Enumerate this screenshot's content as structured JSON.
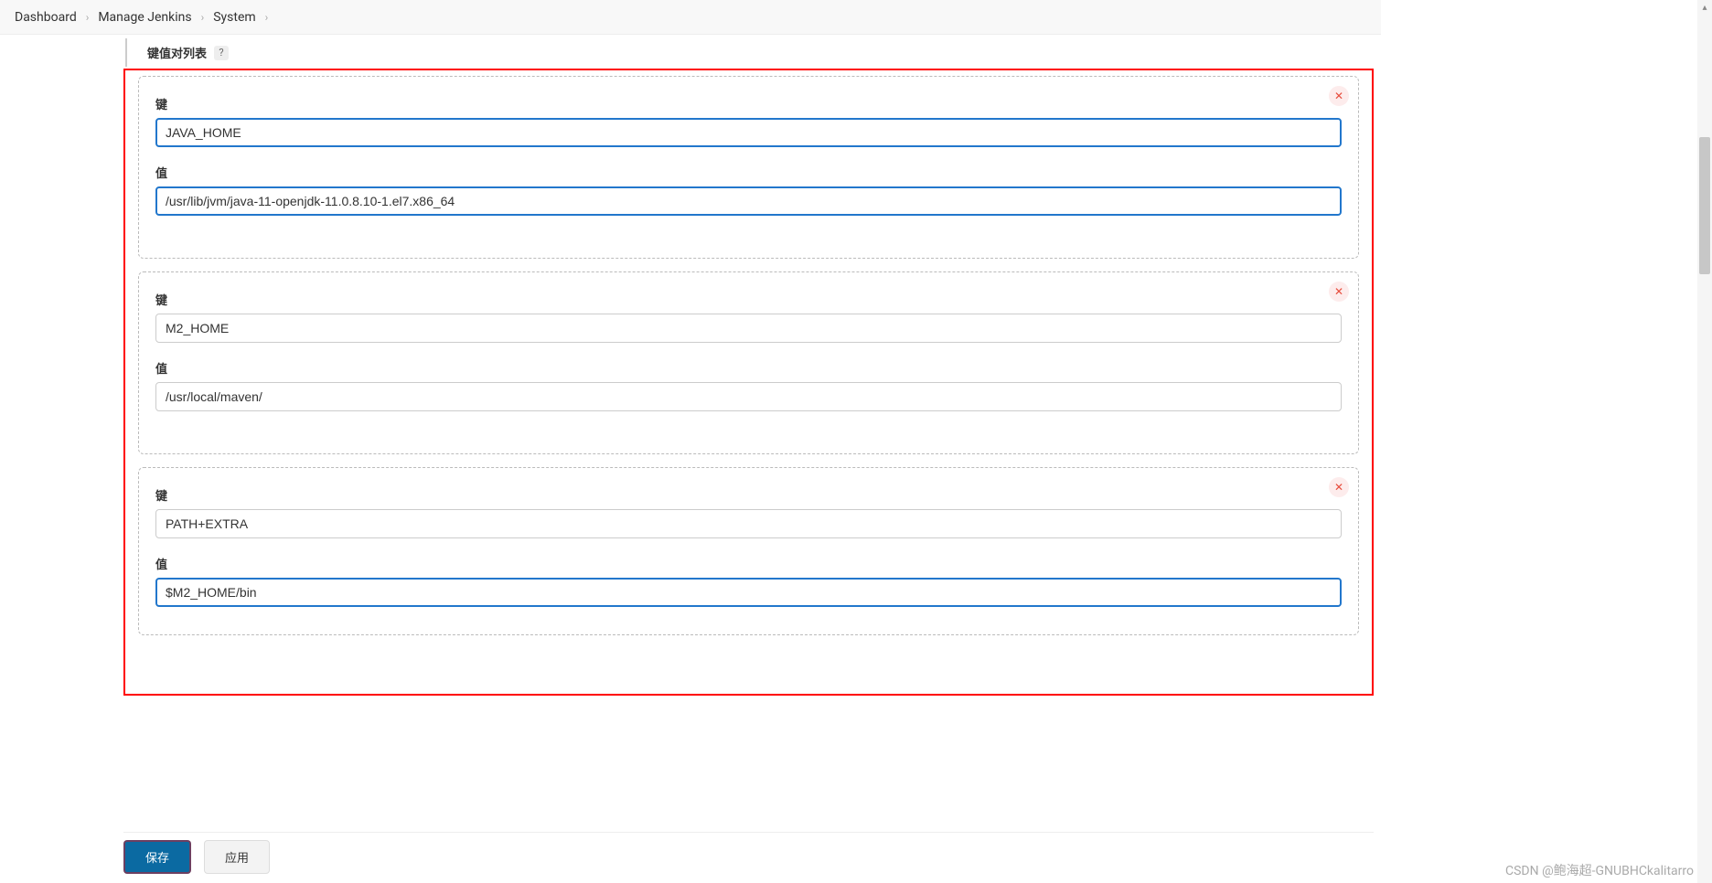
{
  "breadcrumb": {
    "items": [
      "Dashboard",
      "Manage Jenkins",
      "System"
    ]
  },
  "section": {
    "title": "键值对列表",
    "help": "?"
  },
  "labels": {
    "key": "键",
    "value": "值"
  },
  "entries": [
    {
      "key": "JAVA_HOME",
      "value": "/usr/lib/jvm/java-11-openjdk-11.0.8.10-1.el7.x86_64",
      "focusedKey": true
    },
    {
      "key": "M2_HOME",
      "value": "/usr/local/maven/"
    },
    {
      "key": "PATH+EXTRA",
      "value": "$M2_HOME/bin",
      "focusedValue": true
    }
  ],
  "icons": {
    "delete": "✕",
    "chevron": "›",
    "up": "▴"
  },
  "buttons": {
    "save": "保存",
    "apply": "应用"
  },
  "watermark": "CSDN @鲍海超-GNUBHCkalitarro"
}
